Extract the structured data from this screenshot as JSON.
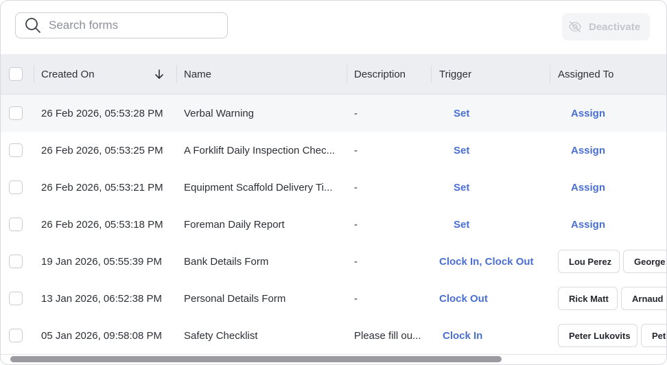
{
  "search": {
    "placeholder": "Search forms"
  },
  "toolbar": {
    "deactivate_label": "Deactivate"
  },
  "columns": {
    "created_on": "Created On",
    "name": "Name",
    "description": "Description",
    "trigger": "Trigger",
    "assigned_to": "Assigned To"
  },
  "rows": [
    {
      "created": "26 Feb 2026, 05:53:28 PM",
      "name": "Verbal Warning",
      "description": "-",
      "trigger": "Set",
      "assign": "Assign",
      "chips": []
    },
    {
      "created": "26 Feb 2026, 05:53:25 PM",
      "name": "A Forklift Daily Inspection Chec...",
      "description": "-",
      "trigger": "Set",
      "assign": "Assign",
      "chips": []
    },
    {
      "created": "26 Feb 2026, 05:53:21 PM",
      "name": "Equipment Scaffold Delivery Ti...",
      "description": "-",
      "trigger": "Set",
      "assign": "Assign",
      "chips": []
    },
    {
      "created": "26 Feb 2026, 05:53:18 PM",
      "name": "Foreman Daily Report",
      "description": "-",
      "trigger": "Set",
      "assign": "Assign",
      "chips": []
    },
    {
      "created": "19 Jan 2026, 05:55:39 PM",
      "name": "Bank Details Form",
      "description": "-",
      "trigger": "Clock In, Clock Out",
      "assign": "",
      "chips": [
        "Lou Perez",
        "George"
      ]
    },
    {
      "created": "13 Jan 2026, 06:52:38 PM",
      "name": "Personal Details Form",
      "description": "-",
      "trigger": "Clock Out",
      "assign": "",
      "chips": [
        "Rick Matt",
        "Arnaud D"
      ]
    },
    {
      "created": "05 Jan 2026, 09:58:08 PM",
      "name": "Safety Checklist",
      "description": "Please fill ou...",
      "trigger": "Clock In",
      "assign": "",
      "chips": [
        "Peter Lukovits",
        "Pete"
      ]
    }
  ]
}
